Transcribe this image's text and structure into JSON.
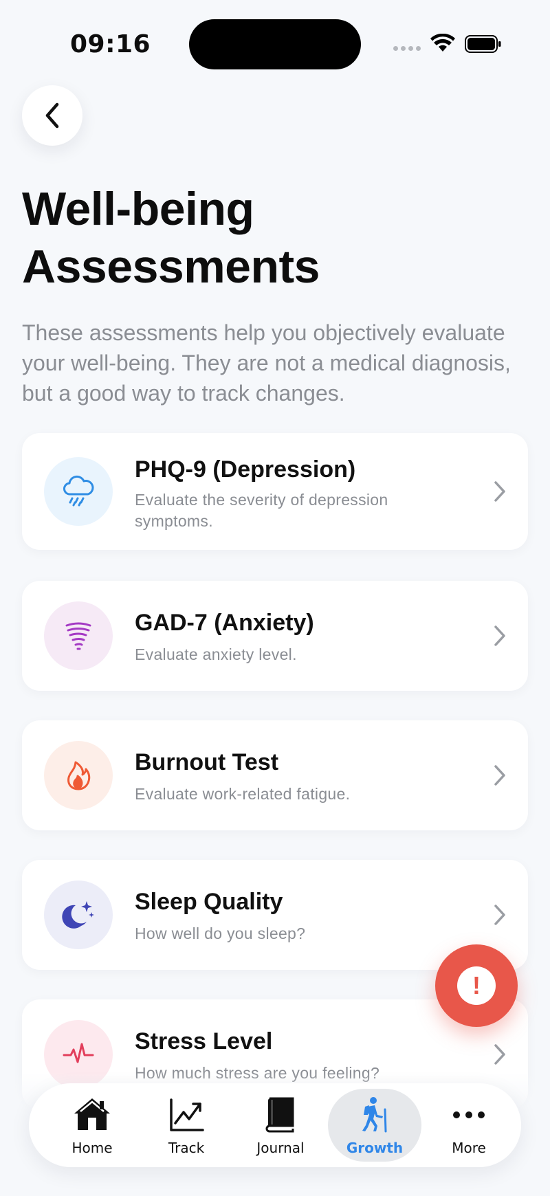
{
  "status_bar": {
    "time": "09:16"
  },
  "header": {
    "title": "Well-being Assessments",
    "description": "These assessments help you objectively evaluate your well-being. They are not a medical diagnosis, but a good way to track changes."
  },
  "assessments": [
    {
      "title": "PHQ-9 (Depression)",
      "subtitle": "Evaluate the severity of depression symptoms.",
      "icon": "rain-cloud-icon",
      "icon_bg": "#e9f4fd",
      "icon_color": "#2f8de4"
    },
    {
      "title": "GAD-7 (Anxiety)",
      "subtitle": "Evaluate anxiety level.",
      "icon": "tornado-icon",
      "icon_bg": "#f6eaf6",
      "icon_color": "#a43ac4"
    },
    {
      "title": "Burnout Test",
      "subtitle": "Evaluate work-related fatigue.",
      "icon": "flame-icon",
      "icon_bg": "#fdeee8",
      "icon_color": "#ef5a35"
    },
    {
      "title": "Sleep Quality",
      "subtitle": "How well do you sleep?",
      "icon": "moon-stars-icon",
      "icon_bg": "#ecedf8",
      "icon_color": "#3f45b5"
    },
    {
      "title": "Stress Level",
      "subtitle": "How much stress are you feeling?",
      "icon": "heart-pulse-icon",
      "icon_bg": "#fde9ee",
      "icon_color": "#e23e5b"
    }
  ],
  "sos": {
    "label": "!"
  },
  "tab_bar": {
    "items": [
      {
        "label": "Home",
        "icon": "home-icon"
      },
      {
        "label": "Track",
        "icon": "chart-line-icon"
      },
      {
        "label": "Journal",
        "icon": "book-icon"
      },
      {
        "label": "Growth",
        "icon": "hiker-icon",
        "active": true
      },
      {
        "label": "More",
        "icon": "more-icon"
      }
    ],
    "active_color": "#2f86e8"
  }
}
